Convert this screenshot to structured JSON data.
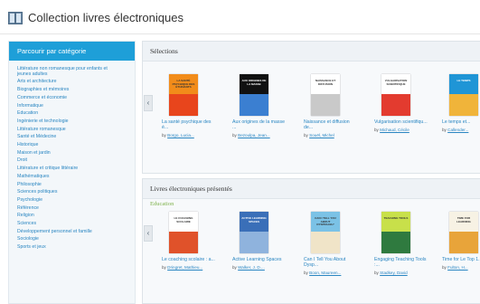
{
  "header": {
    "title": "Collection livres électroniques",
    "icon": "ebook-collection-icon"
  },
  "sidebar": {
    "heading": "Parcourir par catégorie",
    "categories": [
      "Littérature non romanesque pour enfants et jeunes adultes",
      "Arts et architecture",
      "Biographies et mémoires",
      "Commerce et économie",
      "Informatique",
      "Education",
      "Ingénierie et technologie",
      "Littérature romanesque",
      "Santé et Médecine",
      "Historique",
      "Maison et jardin",
      "Droit",
      "Littérature et critique littéraire",
      "Mathématiques",
      "Philosophie",
      "Sciences politiques",
      "Psychologie",
      "Référence",
      "Religion",
      "Sciences",
      "Développement personnel et famille",
      "Sociologie",
      "Sports et jeux"
    ]
  },
  "selections": {
    "heading": "Sélections",
    "prev_arrow": "‹",
    "books": [
      {
        "title": "La santé psychique des é...",
        "by": "by",
        "author": "Borgo, Lucia...",
        "colors": [
          "#f28c1a",
          "#e8451c"
        ],
        "cover_text": "LA SANTÉ PSYCHIQUE DES ÉTUDIANTS"
      },
      {
        "title": "Aux origines de la masse ...",
        "by": "by",
        "author": "Bezoulpa, Jean...",
        "colors": [
          "#111111",
          "#3b7fd1"
        ],
        "cover_text": "AUX ORIGINES DE LA MASSE"
      },
      {
        "title": "Naissance et diffusion de...",
        "by": "by",
        "author": "Souël, Michel",
        "colors": [
          "#ffffff",
          "#c9c9c9"
        ],
        "cover_text": "NAISSANCE ET DIFFUSION"
      },
      {
        "title": "Vulgarisation scientifiqu...",
        "by": "by",
        "author": "Michaud, Cécile",
        "colors": [
          "#ffffff",
          "#e33b2f"
        ],
        "cover_text": "VULGARISATION SCIENTIFIQUE"
      },
      {
        "title": "Le temps et...",
        "by": "by",
        "author": "Callender...",
        "colors": [
          "#1f95d6",
          "#f0b43a"
        ],
        "cover_text": "LE TEMPS"
      }
    ]
  },
  "featured": {
    "heading": "Livres électroniques présentés",
    "subheading": "Education",
    "prev_arrow": "‹",
    "books": [
      {
        "title": "Le coaching scolaire : a...",
        "by": "by",
        "author": "Dringret, Mathieu...",
        "colors": [
          "#ffffff",
          "#e0522a"
        ],
        "cover_text": "LE COACHING SCOLAIRE"
      },
      {
        "title": "Active Learning Spaces",
        "by": "by",
        "author": "Walker, J. D....",
        "colors": [
          "#3a6fb8",
          "#8fb3dd"
        ],
        "cover_text": "ACTIVE LEARNING SPACES"
      },
      {
        "title": "Can I Tell You About Dysp...",
        "by": "by",
        "author": "Boon, Maureen...",
        "colors": [
          "#7bc2e6",
          "#f0e4c8"
        ],
        "cover_text": "CAN I TELL YOU ABOUT DYSPRAXIA?"
      },
      {
        "title": "Engaging Teaching Tools :...",
        "by": "by",
        "author": "Stadkey, David",
        "colors": [
          "#c8e04a",
          "#2f7a3f"
        ],
        "cover_text": "TEACHING TOOLS"
      },
      {
        "title": "Time for Le Top 1...",
        "by": "by",
        "author": "Fulton, H...",
        "colors": [
          "#f7f2e4",
          "#e8a43a"
        ],
        "cover_text": "TIME FOR LEARNING"
      }
    ]
  }
}
